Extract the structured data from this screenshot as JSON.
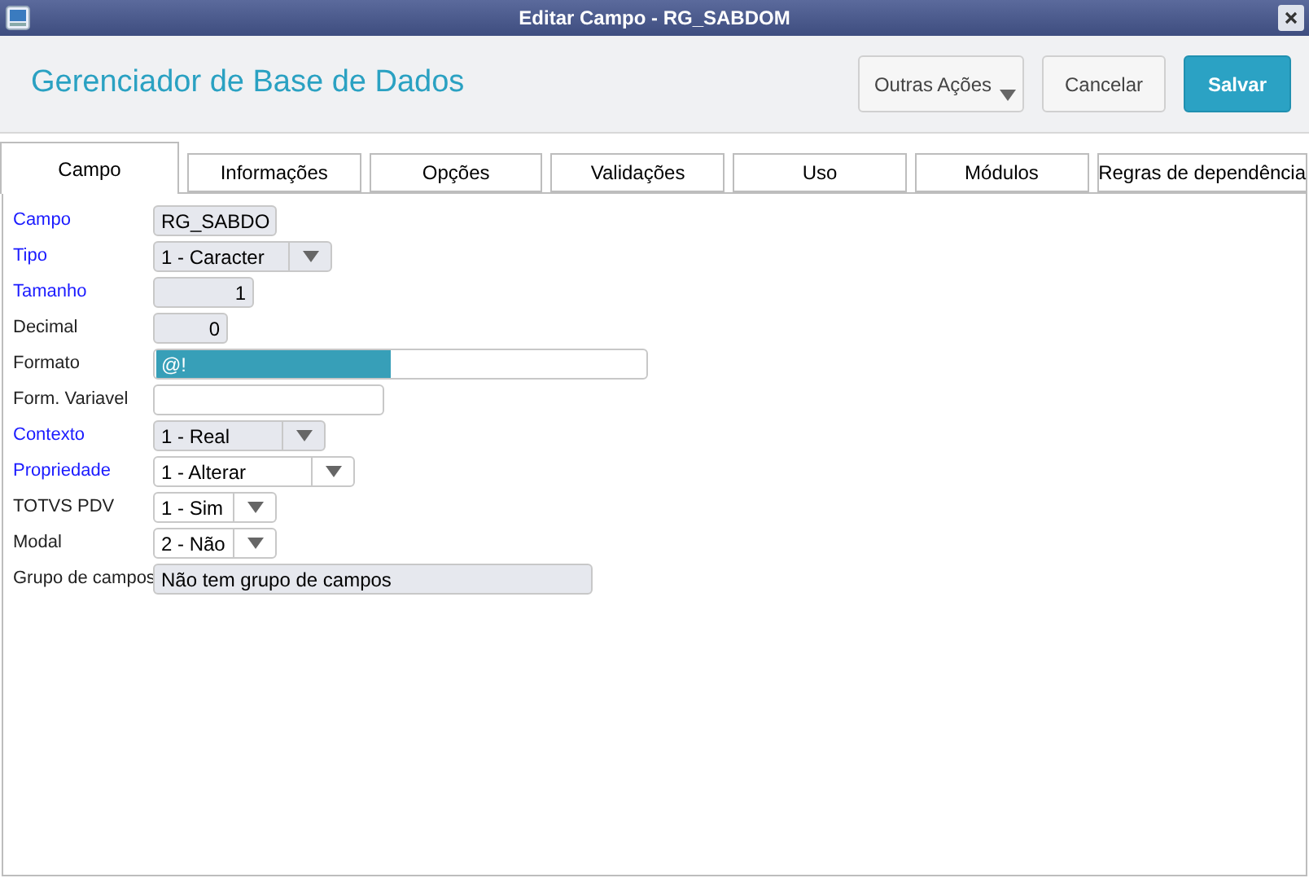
{
  "window": {
    "title": "Editar Campo - RG_SABDOM"
  },
  "header": {
    "title": "Gerenciador de Base de Dados",
    "buttons": [
      {
        "label": "Outras Ações",
        "kind": "menu"
      },
      {
        "label": "Cancelar",
        "kind": "plain"
      },
      {
        "label": "Salvar",
        "kind": "primary"
      }
    ]
  },
  "tabs": [
    {
      "label": "Campo",
      "selected": true
    },
    {
      "label": "Informações",
      "selected": false
    },
    {
      "label": "Opções",
      "selected": false
    },
    {
      "label": "Validações",
      "selected": false
    },
    {
      "label": "Uso",
      "selected": false
    },
    {
      "label": "Módulos",
      "selected": false
    },
    {
      "label": "Regras de dependência",
      "selected": false
    }
  ],
  "fields": [
    {
      "label": "Campo",
      "required": true,
      "kind": "text",
      "value": "RG_SABDO",
      "disabled": true
    },
    {
      "label": "Tipo",
      "required": true,
      "kind": "select",
      "value": "1 - Caracter",
      "disabled": true
    },
    {
      "label": "Tamanho",
      "required": true,
      "kind": "number",
      "value": "1",
      "disabled": true
    },
    {
      "label": "Decimal",
      "required": false,
      "kind": "number",
      "value": "0",
      "disabled": true
    },
    {
      "label": "Formato",
      "required": false,
      "kind": "text",
      "value": "@!",
      "disabled": false,
      "highlighted": true
    },
    {
      "label": "Form. Variavel",
      "required": false,
      "kind": "text",
      "disabled": false
    },
    {
      "label": "Contexto",
      "required": true,
      "kind": "select",
      "value": "1 - Real",
      "disabled": true
    },
    {
      "label": "Propriedade",
      "required": true,
      "kind": "select",
      "value": "1 - Alterar",
      "disabled": false
    },
    {
      "label": "TOTVS PDV",
      "required": false,
      "kind": "select",
      "value": "1 - Sim",
      "disabled": false
    },
    {
      "label": "Modal",
      "required": false,
      "kind": "select",
      "value": "2 - Não",
      "disabled": false
    },
    {
      "label": "Grupo de campos",
      "required": false,
      "kind": "text",
      "value": "Não tem grupo de campos",
      "disabled": true
    }
  ]
}
